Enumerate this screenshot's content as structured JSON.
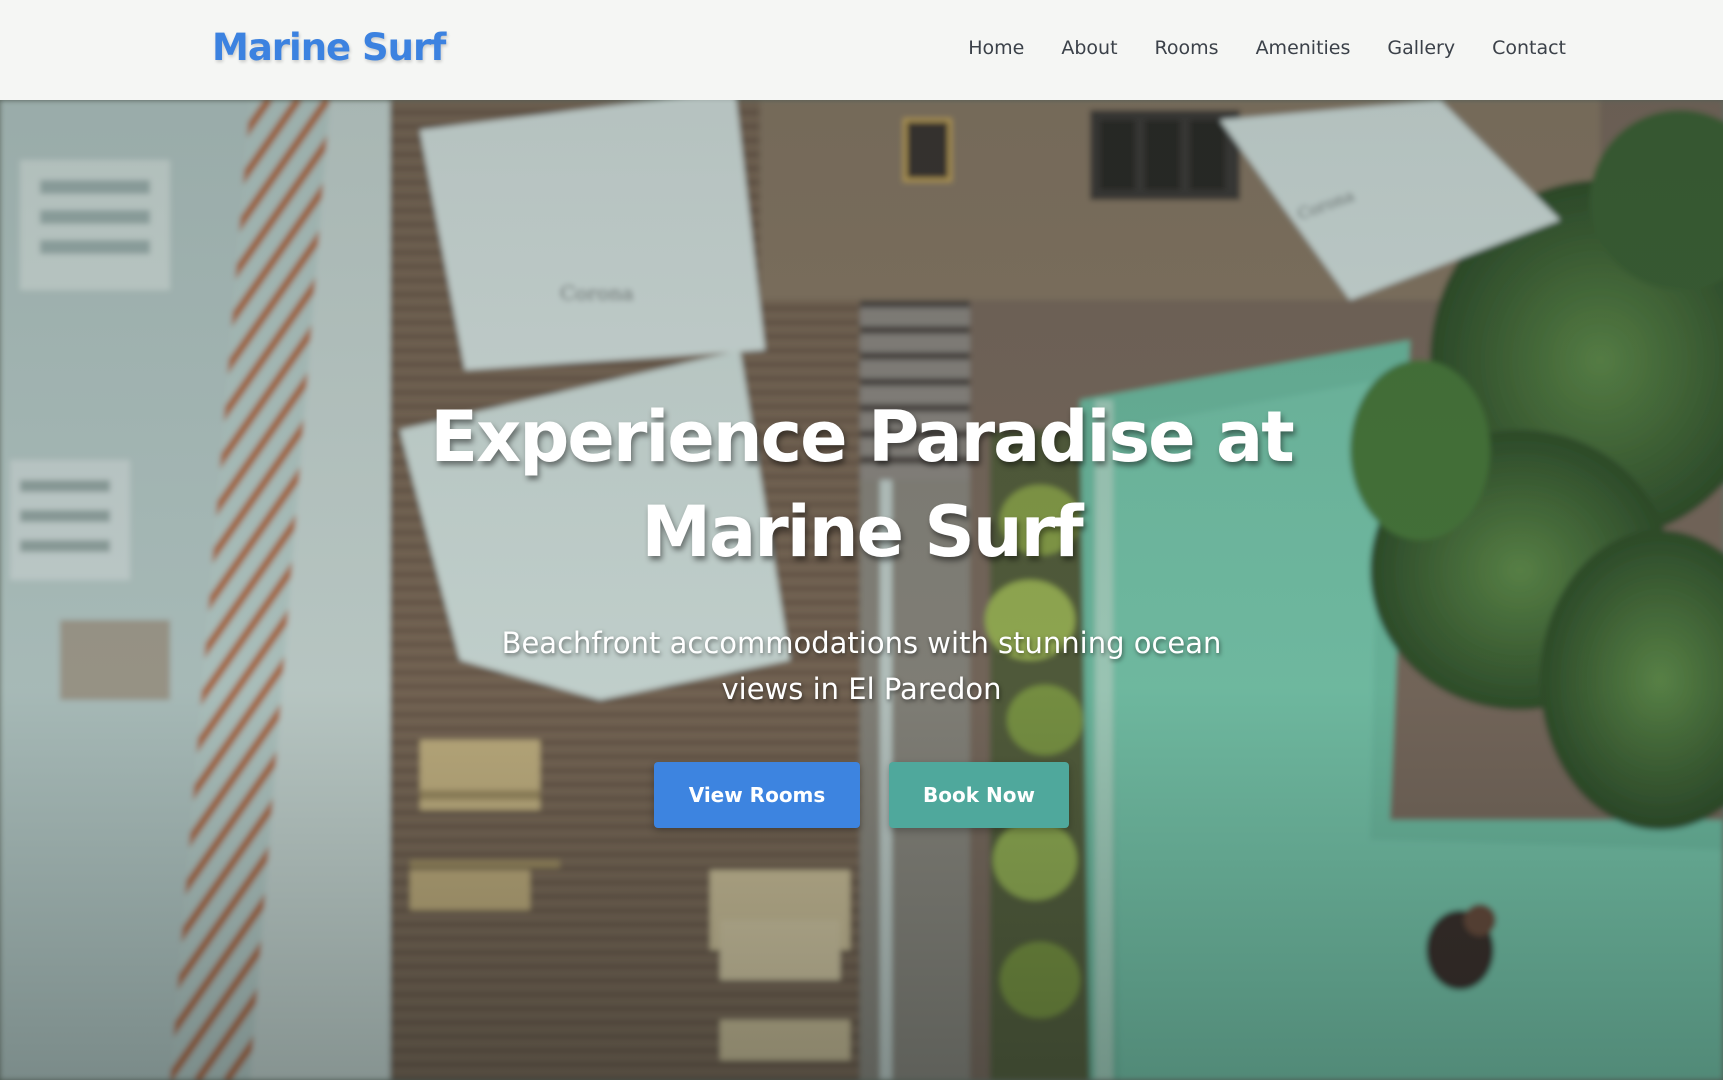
{
  "header": {
    "logo": "Marine Surf",
    "nav": [
      "Home",
      "About",
      "Rooms",
      "Amenities",
      "Gallery",
      "Contact"
    ]
  },
  "hero": {
    "title": "Experience Paradise at Marine Surf",
    "subtitle": "Beachfront accommodations with stunning ocean views in El Paredon",
    "primary_button": "View Rooms",
    "secondary_button": "Book Now",
    "background": "aerial-view-of-hostel-courtyard-with-pool-and-umbrellas"
  },
  "colors": {
    "brand_blue": "#3c82e0",
    "button_blue": "#3d84e0",
    "button_teal": "#4fa89c",
    "nav_text": "#3b4149",
    "header_bg": "#fafaf9"
  }
}
